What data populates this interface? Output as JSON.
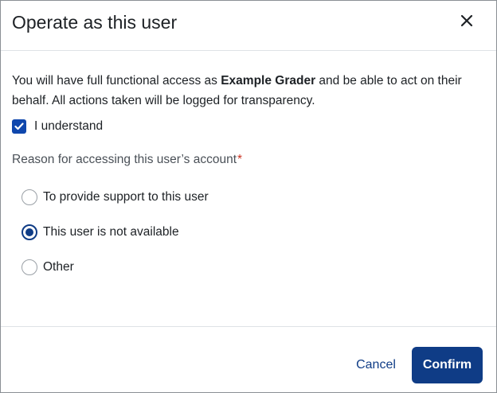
{
  "dialog": {
    "title": "Operate as this user",
    "close_icon": "close-icon"
  },
  "body": {
    "desc_prefix": "You will have full functional access as ",
    "user_name": "Example Grader",
    "desc_suffix": " and be able to act on their behalf. All actions taken will be logged for transparency.",
    "understand_label": "I understand",
    "understand_checked": true,
    "reason_label": "Reason for accessing this user’s account",
    "required_marker": "*",
    "options": [
      {
        "label": "To provide support to this user",
        "checked": false
      },
      {
        "label": "This user is not available",
        "checked": true
      },
      {
        "label": "Other",
        "checked": false
      }
    ]
  },
  "footer": {
    "cancel_label": "Cancel",
    "confirm_label": "Confirm"
  },
  "colors": {
    "primary": "#0f3c86",
    "checkbox": "#0f47ad",
    "required": "#ca3120"
  }
}
